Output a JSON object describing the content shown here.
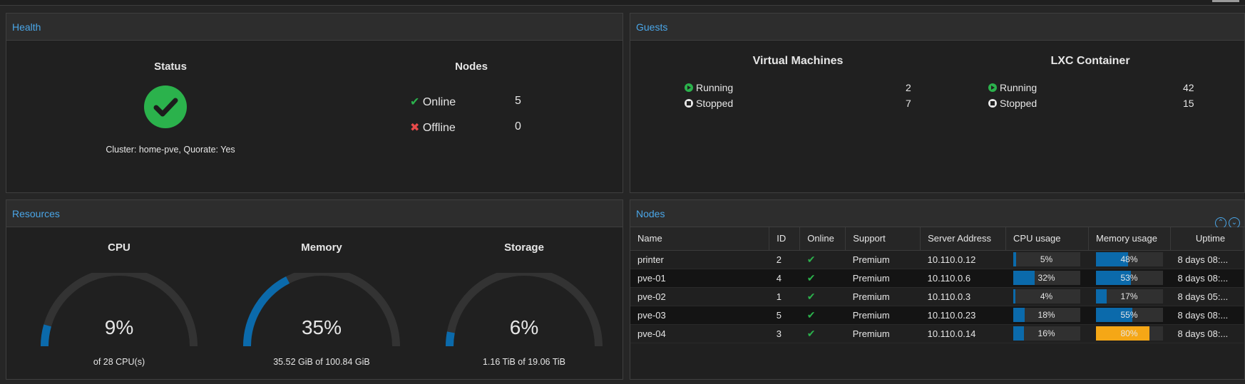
{
  "health": {
    "title": "Health",
    "status_heading": "Status",
    "cluster_line": "Cluster: home-pve, Quorate: Yes",
    "nodes_heading": "Nodes",
    "online_label": "Online",
    "online_count": "5",
    "offline_label": "Offline",
    "offline_count": "0"
  },
  "guests": {
    "title": "Guests",
    "vm_heading": "Virtual Machines",
    "lxc_heading": "LXC Container",
    "vm_running_label": "Running",
    "vm_running": "2",
    "vm_stopped_label": "Stopped",
    "vm_stopped": "7",
    "lxc_running_label": "Running",
    "lxc_running": "42",
    "lxc_stopped_label": "Stopped",
    "lxc_stopped": "15"
  },
  "resources": {
    "title": "Resources",
    "gauges": [
      {
        "label": "CPU",
        "percent_text": "9%",
        "fraction": 0.09,
        "sub": "of 28 CPU(s)"
      },
      {
        "label": "Memory",
        "percent_text": "35%",
        "fraction": 0.35,
        "sub": "35.52 GiB of 100.84 GiB"
      },
      {
        "label": "Storage",
        "percent_text": "6%",
        "fraction": 0.06,
        "sub": "1.16 TiB of 19.06 TiB"
      }
    ]
  },
  "nodes": {
    "title": "Nodes",
    "columns": [
      "Name",
      "ID",
      "Online",
      "Support",
      "Server Address",
      "CPU usage",
      "Memory usage",
      "Uptime"
    ],
    "rows": [
      {
        "name": "printer",
        "id": "2",
        "online": "✔",
        "support": "Premium",
        "address": "10.110.0.12",
        "cpu_text": "5%",
        "cpu": 0.05,
        "mem_text": "48%",
        "mem": 0.48,
        "uptime": "8 days 08:..."
      },
      {
        "name": "pve-01",
        "id": "4",
        "online": "✔",
        "support": "Premium",
        "address": "10.110.0.6",
        "cpu_text": "32%",
        "cpu": 0.32,
        "mem_text": "53%",
        "mem": 0.53,
        "uptime": "8 days 08:..."
      },
      {
        "name": "pve-02",
        "id": "1",
        "online": "✔",
        "support": "Premium",
        "address": "10.110.0.3",
        "cpu_text": "4%",
        "cpu": 0.04,
        "mem_text": "17%",
        "mem": 0.17,
        "uptime": "8 days 05:..."
      },
      {
        "name": "pve-03",
        "id": "5",
        "online": "✔",
        "support": "Premium",
        "address": "10.110.0.23",
        "cpu_text": "18%",
        "cpu": 0.18,
        "mem_text": "55%",
        "mem": 0.55,
        "uptime": "8 days 08:..."
      },
      {
        "name": "pve-04",
        "id": "3",
        "online": "✔",
        "support": "Premium",
        "address": "10.110.0.14",
        "cpu_text": "16%",
        "cpu": 0.16,
        "mem_text": "80%",
        "mem": 0.8,
        "uptime": "8 days 08:..."
      }
    ]
  },
  "colors": {
    "accent": "#4aa6e8",
    "ok": "#2bb24c",
    "error": "#e84a4a",
    "bar": "#0b6aab",
    "warn": "#f5a716"
  }
}
